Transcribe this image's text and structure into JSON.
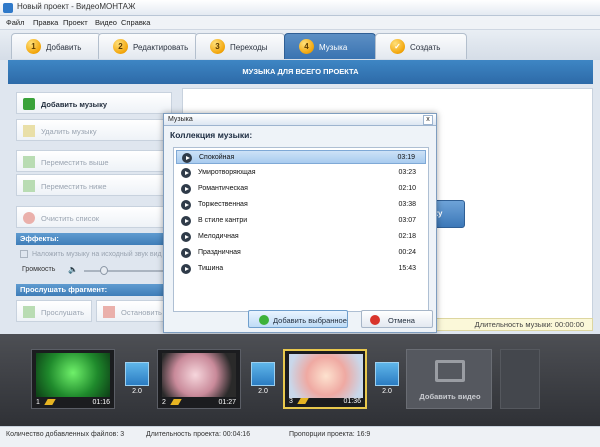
{
  "window": {
    "title": "Новый проект - ВидеоМОНТАЖ"
  },
  "menu": [
    "Файл",
    "Правка",
    "Проект",
    "Видео",
    "Справка"
  ],
  "tabs": [
    {
      "num": "1",
      "label": "Добавить"
    },
    {
      "num": "2",
      "label": "Редактировать"
    },
    {
      "num": "3",
      "label": "Переходы"
    },
    {
      "num": "4",
      "label": "Музыка"
    },
    {
      "num": "✓",
      "label": "Создать"
    }
  ],
  "section_title": "МУЗЫКА ДЛЯ ВСЕГО ПРОЕКТА",
  "left": {
    "add_music": "Добавить музыку",
    "delete_music": "Удалить музыку",
    "move_up": "Переместить выше",
    "move_down": "Переместить ниже",
    "clear_list": "Очистить список",
    "effects_header": "Эффекты:",
    "overlay_label": "Наложить музыку на исходный звук вид",
    "volume_label": "Громкость",
    "preview_header": "Прослушать фрагмент:",
    "listen": "Прослушать",
    "stop": "Остановить"
  },
  "main": {
    "background_button": "ку",
    "duration_label": "Длительность музыки: 00:00:00"
  },
  "dialog": {
    "title": "Музыка",
    "close": "x",
    "heading": "Коллекция музыки:",
    "tracks": [
      {
        "name": "Спокойная",
        "time": "03:19"
      },
      {
        "name": "Умиротворяющая",
        "time": "03:23"
      },
      {
        "name": "Романтическая",
        "time": "02:10"
      },
      {
        "name": "Торжественная",
        "time": "03:38"
      },
      {
        "name": "В стиле кантри",
        "time": "03:07"
      },
      {
        "name": "Мелодичная",
        "time": "02:18"
      },
      {
        "name": "Праздничная",
        "time": "00:24"
      },
      {
        "name": "Тишина",
        "time": "15:43"
      }
    ],
    "add_selected": "Добавить выбранное",
    "cancel": "Отмена"
  },
  "timeline": {
    "clips": [
      {
        "num": "1",
        "duration": "01:16"
      },
      {
        "num": "2",
        "duration": "01:27"
      },
      {
        "num": "3",
        "duration": "01:36"
      }
    ],
    "transitions": [
      "2.0",
      "2.0",
      "2.0"
    ],
    "add_video": "Добавить видео"
  },
  "status": {
    "files": "Количество добавленных файлов: 3",
    "duration": "Длительность проекта: 00:04:16",
    "ratio": "Пропорции проекта: 16:9"
  }
}
